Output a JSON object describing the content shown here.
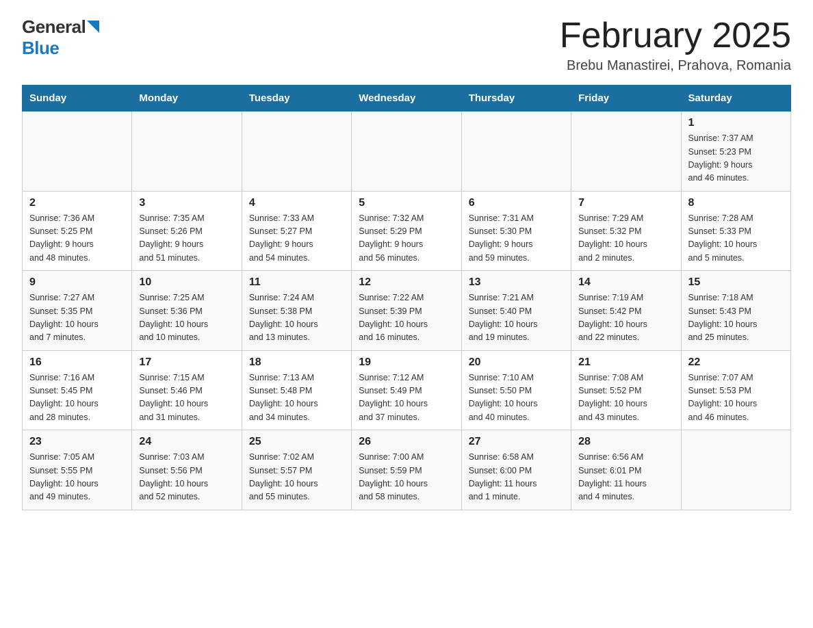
{
  "header": {
    "logo_general": "General",
    "logo_blue": "Blue",
    "month_title": "February 2025",
    "location": "Brebu Manastirei, Prahova, Romania"
  },
  "days_of_week": [
    "Sunday",
    "Monday",
    "Tuesday",
    "Wednesday",
    "Thursday",
    "Friday",
    "Saturday"
  ],
  "weeks": [
    [
      {
        "day": "",
        "info": ""
      },
      {
        "day": "",
        "info": ""
      },
      {
        "day": "",
        "info": ""
      },
      {
        "day": "",
        "info": ""
      },
      {
        "day": "",
        "info": ""
      },
      {
        "day": "",
        "info": ""
      },
      {
        "day": "1",
        "info": "Sunrise: 7:37 AM\nSunset: 5:23 PM\nDaylight: 9 hours\nand 46 minutes."
      }
    ],
    [
      {
        "day": "2",
        "info": "Sunrise: 7:36 AM\nSunset: 5:25 PM\nDaylight: 9 hours\nand 48 minutes."
      },
      {
        "day": "3",
        "info": "Sunrise: 7:35 AM\nSunset: 5:26 PM\nDaylight: 9 hours\nand 51 minutes."
      },
      {
        "day": "4",
        "info": "Sunrise: 7:33 AM\nSunset: 5:27 PM\nDaylight: 9 hours\nand 54 minutes."
      },
      {
        "day": "5",
        "info": "Sunrise: 7:32 AM\nSunset: 5:29 PM\nDaylight: 9 hours\nand 56 minutes."
      },
      {
        "day": "6",
        "info": "Sunrise: 7:31 AM\nSunset: 5:30 PM\nDaylight: 9 hours\nand 59 minutes."
      },
      {
        "day": "7",
        "info": "Sunrise: 7:29 AM\nSunset: 5:32 PM\nDaylight: 10 hours\nand 2 minutes."
      },
      {
        "day": "8",
        "info": "Sunrise: 7:28 AM\nSunset: 5:33 PM\nDaylight: 10 hours\nand 5 minutes."
      }
    ],
    [
      {
        "day": "9",
        "info": "Sunrise: 7:27 AM\nSunset: 5:35 PM\nDaylight: 10 hours\nand 7 minutes."
      },
      {
        "day": "10",
        "info": "Sunrise: 7:25 AM\nSunset: 5:36 PM\nDaylight: 10 hours\nand 10 minutes."
      },
      {
        "day": "11",
        "info": "Sunrise: 7:24 AM\nSunset: 5:38 PM\nDaylight: 10 hours\nand 13 minutes."
      },
      {
        "day": "12",
        "info": "Sunrise: 7:22 AM\nSunset: 5:39 PM\nDaylight: 10 hours\nand 16 minutes."
      },
      {
        "day": "13",
        "info": "Sunrise: 7:21 AM\nSunset: 5:40 PM\nDaylight: 10 hours\nand 19 minutes."
      },
      {
        "day": "14",
        "info": "Sunrise: 7:19 AM\nSunset: 5:42 PM\nDaylight: 10 hours\nand 22 minutes."
      },
      {
        "day": "15",
        "info": "Sunrise: 7:18 AM\nSunset: 5:43 PM\nDaylight: 10 hours\nand 25 minutes."
      }
    ],
    [
      {
        "day": "16",
        "info": "Sunrise: 7:16 AM\nSunset: 5:45 PM\nDaylight: 10 hours\nand 28 minutes."
      },
      {
        "day": "17",
        "info": "Sunrise: 7:15 AM\nSunset: 5:46 PM\nDaylight: 10 hours\nand 31 minutes."
      },
      {
        "day": "18",
        "info": "Sunrise: 7:13 AM\nSunset: 5:48 PM\nDaylight: 10 hours\nand 34 minutes."
      },
      {
        "day": "19",
        "info": "Sunrise: 7:12 AM\nSunset: 5:49 PM\nDaylight: 10 hours\nand 37 minutes."
      },
      {
        "day": "20",
        "info": "Sunrise: 7:10 AM\nSunset: 5:50 PM\nDaylight: 10 hours\nand 40 minutes."
      },
      {
        "day": "21",
        "info": "Sunrise: 7:08 AM\nSunset: 5:52 PM\nDaylight: 10 hours\nand 43 minutes."
      },
      {
        "day": "22",
        "info": "Sunrise: 7:07 AM\nSunset: 5:53 PM\nDaylight: 10 hours\nand 46 minutes."
      }
    ],
    [
      {
        "day": "23",
        "info": "Sunrise: 7:05 AM\nSunset: 5:55 PM\nDaylight: 10 hours\nand 49 minutes."
      },
      {
        "day": "24",
        "info": "Sunrise: 7:03 AM\nSunset: 5:56 PM\nDaylight: 10 hours\nand 52 minutes."
      },
      {
        "day": "25",
        "info": "Sunrise: 7:02 AM\nSunset: 5:57 PM\nDaylight: 10 hours\nand 55 minutes."
      },
      {
        "day": "26",
        "info": "Sunrise: 7:00 AM\nSunset: 5:59 PM\nDaylight: 10 hours\nand 58 minutes."
      },
      {
        "day": "27",
        "info": "Sunrise: 6:58 AM\nSunset: 6:00 PM\nDaylight: 11 hours\nand 1 minute."
      },
      {
        "day": "28",
        "info": "Sunrise: 6:56 AM\nSunset: 6:01 PM\nDaylight: 11 hours\nand 4 minutes."
      },
      {
        "day": "",
        "info": ""
      }
    ]
  ]
}
